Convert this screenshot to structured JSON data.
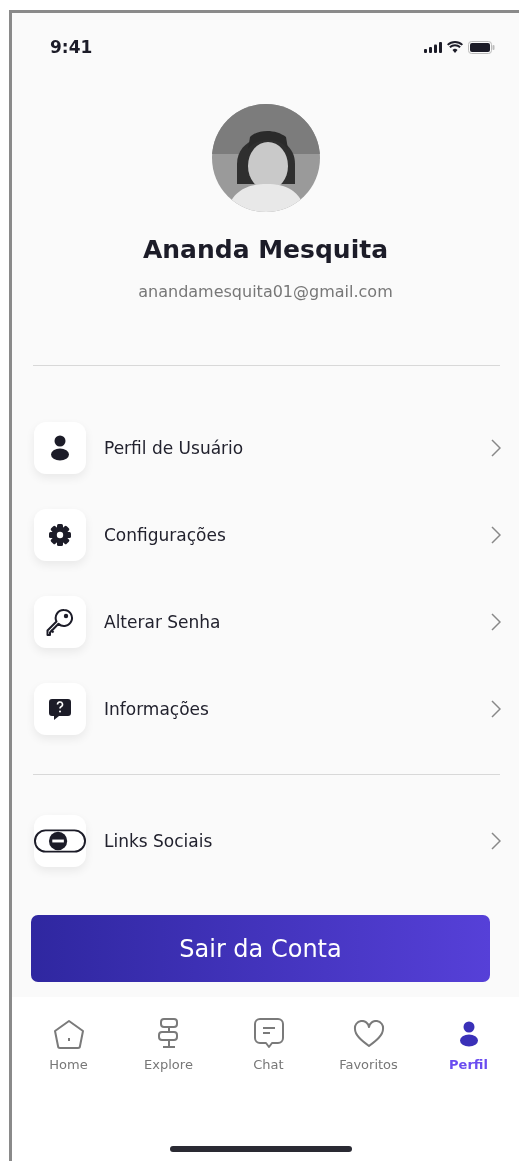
{
  "status_bar": {
    "time": "9:41"
  },
  "profile": {
    "name": "Ananda Mesquita",
    "email": "anandamesquita01@gmail.com"
  },
  "menu_groups": [
    {
      "items": [
        {
          "kind": "user",
          "label": "Perfil de Usuário"
        },
        {
          "kind": "gear",
          "label": "Configurações"
        },
        {
          "kind": "key",
          "label": "Alterar Senha"
        },
        {
          "kind": "help",
          "label": "Informações"
        }
      ]
    },
    {
      "items": [
        {
          "kind": "toggle",
          "label": "Links Sociais"
        }
      ]
    }
  ],
  "logout_button": "Sair da Conta",
  "bottom_nav": [
    {
      "kind": "home",
      "label": "Home",
      "selected": false
    },
    {
      "kind": "signpost",
      "label": "Explore",
      "selected": false
    },
    {
      "kind": "chat",
      "label": "Chat",
      "selected": false
    },
    {
      "kind": "heart",
      "label": "Favoritos",
      "selected": false
    },
    {
      "kind": "user",
      "label": "Perfil",
      "selected": true
    }
  ]
}
